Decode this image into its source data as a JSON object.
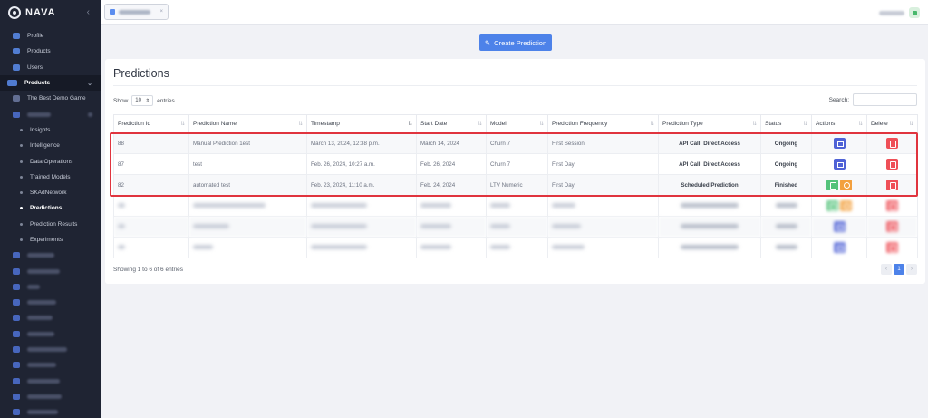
{
  "brand": {
    "name": "NAVA"
  },
  "sidebar": {
    "collapse_icon": "chevron-left-icon",
    "top_items": [
      {
        "label": "Profile",
        "icon": "user-icon"
      },
      {
        "label": "Products",
        "icon": "rocket-icon"
      },
      {
        "label": "Users",
        "icon": "users-icon"
      }
    ],
    "products_section": {
      "label": "Products",
      "icon": "sitemap-icon",
      "chevron": "chevron-down-icon"
    },
    "game": {
      "label": "The Best Demo Game",
      "icon": "gamepad-icon"
    },
    "sub_items": [
      {
        "label": "Insights",
        "active": false
      },
      {
        "label": "Intelligence",
        "active": false
      },
      {
        "label": "Data Operations",
        "active": false
      },
      {
        "label": "Trained Models",
        "active": false
      },
      {
        "label": "SKAdNetwork",
        "active": false
      },
      {
        "label": "Predictions",
        "active": true
      },
      {
        "label": "Prediction Results",
        "active": false
      },
      {
        "label": "Experiments",
        "active": false
      }
    ]
  },
  "topbar": {
    "close_glyph": "×"
  },
  "create_button": {
    "label": "Create Prediction",
    "icon": "magic-wand-icon"
  },
  "card": {
    "title": "Predictions",
    "show_label": "Show",
    "entries_label": "entries",
    "page_length": "10",
    "search_label": "Search:",
    "search_placeholder": ""
  },
  "table": {
    "columns": [
      "Prediction Id",
      "Prediction Name",
      "Timestamp",
      "Start Date",
      "Model",
      "Prediction Frequency",
      "Prediction Type",
      "Status",
      "Actions",
      "Delete"
    ],
    "rows": [
      {
        "id": "88",
        "name": "Manual Prediction 1est",
        "timestamp": "March 13, 2024, 12:38 p.m.",
        "start": "March 14, 2024",
        "model": "Churn 7",
        "frequency": "First Session",
        "type": "API Call: Direct Access",
        "status": "Ongoing"
      },
      {
        "id": "87",
        "name": "test",
        "timestamp": "Feb. 26, 2024, 10:27 a.m.",
        "start": "Feb. 26, 2024",
        "model": "Churn 7",
        "frequency": "First Day",
        "type": "API Call: Direct Access",
        "status": "Ongoing"
      },
      {
        "id": "82",
        "name": "automated test",
        "timestamp": "Feb. 23, 2024, 11:10 a.m.",
        "start": "Feb. 24, 2024",
        "model": "LTV Numeric",
        "frequency": "First Day",
        "type": "Scheduled Prediction",
        "status": "Finished"
      }
    ]
  },
  "footer": {
    "info": "Showing 1 to 6 of 6 entries",
    "pages": [
      "‹",
      "1",
      "›"
    ],
    "current_page": "1"
  },
  "colors": {
    "accent": "#4d82e9",
    "sidebar_bg": "#1f2433",
    "delete": "#ef4f57",
    "edit": "#53c27a",
    "stop": "#f3a03e",
    "code": "#4f62d6",
    "highlight": "#e0343e"
  }
}
